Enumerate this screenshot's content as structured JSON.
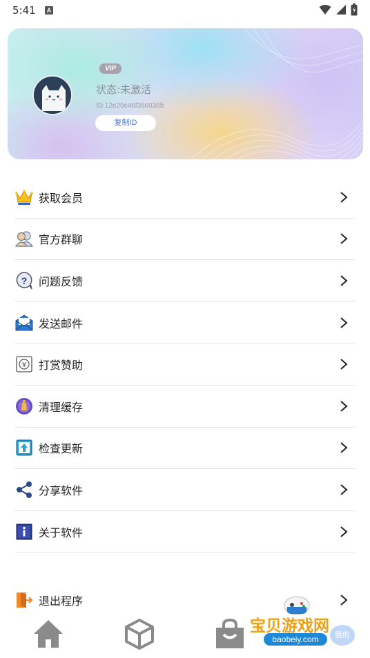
{
  "status_bar": {
    "time": "5:41",
    "a_badge": "A"
  },
  "profile": {
    "vip_badge": "VIP",
    "status": "状态:未激活",
    "id": "ID:12e29c46f366036b",
    "copy_button": "复制ID"
  },
  "menu": {
    "items": [
      {
        "label": "获取会员",
        "icon": "crown-icon"
      },
      {
        "label": "官方群聊",
        "icon": "group-chat-icon"
      },
      {
        "label": "问题反馈",
        "icon": "question-icon"
      },
      {
        "label": "发送邮件",
        "icon": "mail-icon"
      },
      {
        "label": "打赏赞助",
        "icon": "yen-icon"
      },
      {
        "label": "清理缓存",
        "icon": "clean-icon"
      },
      {
        "label": "检查更新",
        "icon": "update-icon"
      },
      {
        "label": "分享软件",
        "icon": "share-icon"
      },
      {
        "label": "关于软件",
        "icon": "info-icon"
      }
    ],
    "exit": {
      "label": "退出程序",
      "icon": "exit-icon"
    }
  },
  "bottom_nav": {
    "items": [
      {
        "icon": "home-icon"
      },
      {
        "icon": "cube-icon"
      },
      {
        "icon": "bag-icon"
      }
    ]
  },
  "watermark": {
    "text": "宝贝游戏网",
    "url": "baobeiy.com",
    "mine": "我的"
  },
  "colors": {
    "accent": "#4b79d8",
    "divider": "#e4e4e4",
    "nav_icon": "#8a8a8a"
  }
}
